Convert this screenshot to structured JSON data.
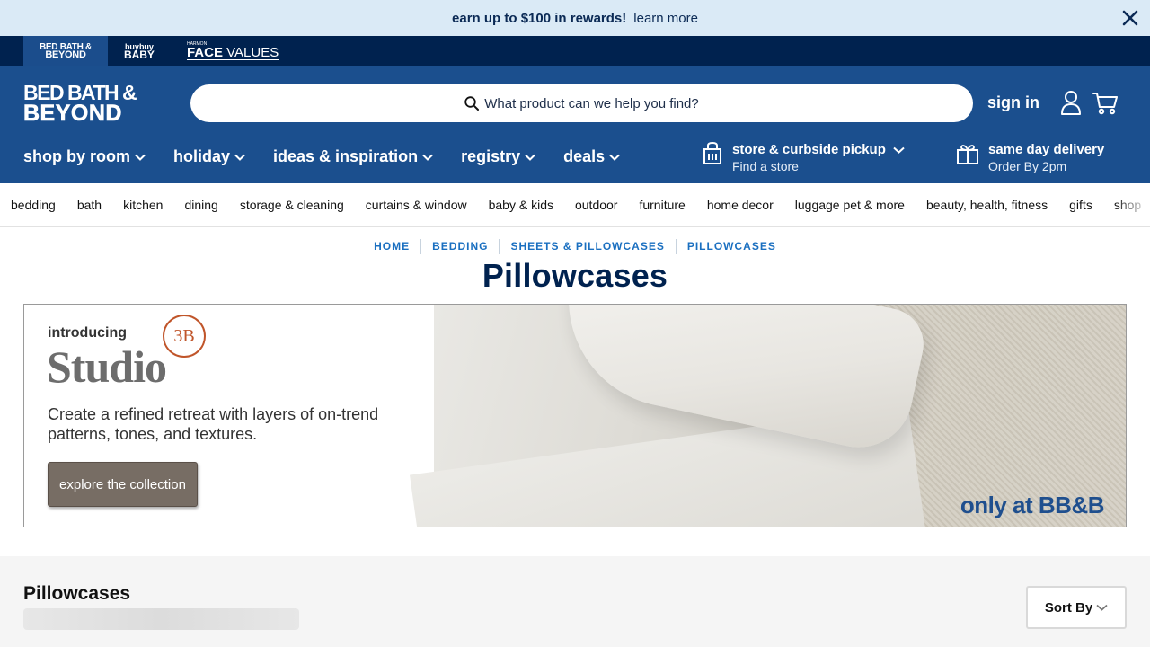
{
  "promo": {
    "headline": "earn up to $100 in rewards!",
    "link": "learn more"
  },
  "brands": {
    "bbb_line1": "BED BATH &",
    "bbb_line2": "BEYOND",
    "baby_line1": "buybuy",
    "baby_line2": "BABY",
    "face_small": "HARMON",
    "face_bold": "FACE",
    "face_light": "VALUES"
  },
  "header": {
    "logo_line1": "BED BATH &",
    "logo_line2": "BEYOND",
    "search_placeholder": "What product can we help you find?",
    "sign_in": "sign in"
  },
  "main_nav": [
    {
      "label": "shop by room"
    },
    {
      "label": "holiday"
    },
    {
      "label": "ideas & inspiration"
    },
    {
      "label": "registry"
    },
    {
      "label": "deals"
    }
  ],
  "services": {
    "store_title": "store & curbside pickup",
    "store_sub": "Find a store",
    "delivery_title": "same day delivery",
    "delivery_sub": "Order By 2pm"
  },
  "categories": [
    "bedding",
    "bath",
    "kitchen",
    "dining",
    "storage & cleaning",
    "curtains & window",
    "baby & kids",
    "outdoor",
    "furniture",
    "home decor",
    "luggage pet & more",
    "beauty, health, fitness",
    "gifts",
    "shop"
  ],
  "breadcrumb": [
    "HOME",
    "BEDDING",
    "SHEETS & PILLOWCASES",
    "PILLOWCASES"
  ],
  "page_title": "Pillowcases",
  "banner": {
    "intro": "introducing",
    "badge": "3B",
    "studio": "Studio",
    "description": "Create a refined retreat with layers of on-trend patterns, tones, and textures.",
    "cta": "explore the collection",
    "tagline": "only at BB&B"
  },
  "listing": {
    "title": "Pillowcases",
    "sort_label": "Sort By"
  }
}
